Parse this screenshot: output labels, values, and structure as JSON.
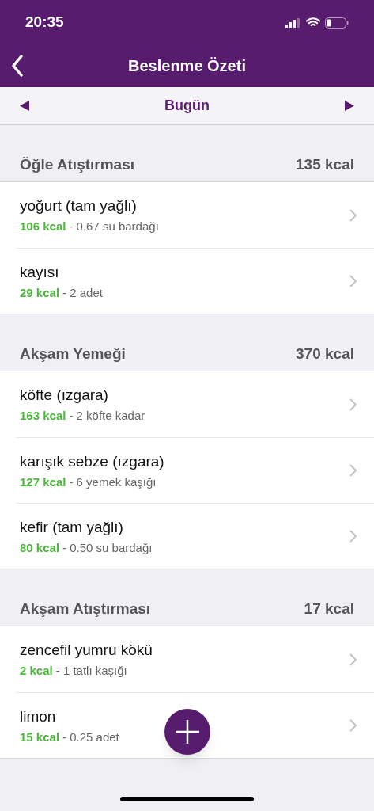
{
  "status_bar": {
    "time": "20:35"
  },
  "nav": {
    "title": "Beslenme Özeti"
  },
  "date_bar": {
    "label": "Bugün"
  },
  "meals": [
    {
      "name": "Öğle Atıştırması",
      "total": "135 kcal",
      "items": [
        {
          "name": "yoğurt (tam yağlı)",
          "kcal": "106 kcal",
          "portion": "- 0.67 su bardağı"
        },
        {
          "name": "kayısı",
          "kcal": "29 kcal",
          "portion": "- 2 adet"
        }
      ]
    },
    {
      "name": "Akşam Yemeği",
      "total": "370 kcal",
      "items": [
        {
          "name": "köfte (ızgara)",
          "kcal": "163 kcal",
          "portion": "- 2 köfte kadar"
        },
        {
          "name": "karışık sebze (ızgara)",
          "kcal": "127 kcal",
          "portion": "- 6 yemek kaşığı"
        },
        {
          "name": "kefir (tam yağlı)",
          "kcal": "80 kcal",
          "portion": "- 0.50 su bardağı"
        }
      ]
    },
    {
      "name": "Akşam Atıştırması",
      "total": "17 kcal",
      "items": [
        {
          "name": "zencefil yumru kökü",
          "kcal": "2 kcal",
          "portion": "- 1 tatlı kaşığı"
        },
        {
          "name": "limon",
          "kcal": "15 kcal",
          "portion": "- 0.25 adet"
        }
      ]
    }
  ]
}
